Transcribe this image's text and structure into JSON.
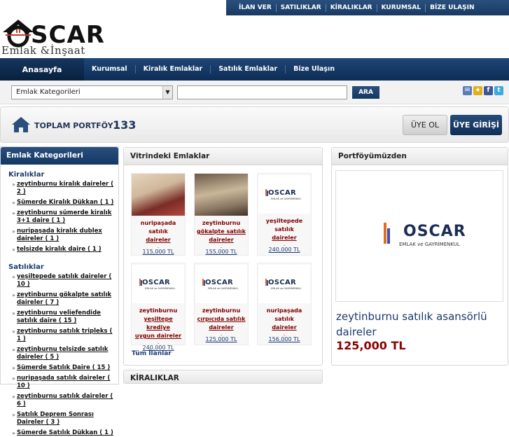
{
  "toplinks": [
    "İLAN VER",
    "SATILIKLAR",
    "KİRALIKLAR",
    "KURUMSAL",
    "BİZE ULAŞIN"
  ],
  "logo": {
    "word": "SCAR",
    "sub": "Emlak &İnşaat"
  },
  "nav": {
    "home": "Anasayfa",
    "items": [
      "Kurumsal",
      "Kiralık Emlaklar",
      "Satılık Emlaklar",
      "Bize Ulaşın"
    ]
  },
  "search": {
    "select_value": "Emlak Kategorileri",
    "button": "ARA"
  },
  "portfolio": {
    "label": "TOPLAM PORTFÖY :",
    "count": "133",
    "register": "ÜYE OL",
    "login": "ÜYE GİRİŞİ"
  },
  "sidebar": {
    "title": "Emlak Kategorileri",
    "kiraliklar_title": "Kiralıklar",
    "kiraliklar": [
      "zeytinburnu kiralık daireler ( 2 )",
      "Sümerde Kiralık Dükkan ( 1 )",
      "zeytinburnu sümerde kiralık 3+1 daire ( 1 )",
      "nuripaşada kiralık dublex daireler ( 1 )",
      "telsizde kiralık daire ( 1 )"
    ],
    "satiliklar_title": "Satılıklar",
    "satiliklar": [
      "yeşiltepede satılık daireler ( 10 )",
      "zeytinburnu gökalpte satılık daireler ( 7 )",
      "zeytinburnu veliefendide satılık daire ( 15 )",
      "zeytinburnu satılık tripleks ( 1 )",
      "zeytinburnu telsizde satılık daireler ( 5 )",
      "Sümerde Satılık Daire ( 15 )",
      "nuripaşada satılık daireler ( 10 )",
      "zeytinburnu satılık daireler ( 6 )",
      "Satılık Deprem Sonrası Daireler ( 3 )",
      "Sümerde Satılık Dükkan ( 1 )"
    ]
  },
  "vitrin": {
    "title": "Vitrindeki Emlaklar",
    "cards": [
      {
        "line1": "nuripaşada satılık",
        "line2": "daireler",
        "line3": "",
        "price": "115,000 TL"
      },
      {
        "line1": "zeytinburnu",
        "line2": "gökalpte satılık",
        "line3": "daireler",
        "price": "155,000 TL"
      },
      {
        "line1": "yeşiltepede satılık",
        "line2": "daireler",
        "line3": "",
        "price": "240,000 TL"
      },
      {
        "line1": "zeytinburnu",
        "line2": "yeşiltepe krediye",
        "line3": "uygun daireler",
        "price": "240,000 TL"
      },
      {
        "line1": "zeytinburnu",
        "line2": "çırpıcıda satılık",
        "line3": "daireler",
        "price": "125,000 TL"
      },
      {
        "line1": "nuripaşada satılık",
        "line2": "daireler",
        "line3": "",
        "price": "156,000 TL"
      }
    ],
    "all_link": "Tüm İlanlar",
    "logo_word": "OSCAR",
    "logo_sub": "EMLAK ve GAYRİMENKUL"
  },
  "portfoy": {
    "title": "Portföyümüzden",
    "logo_word": "OSCAR",
    "logo_sub": "EMLAK ve GAYRİMENKUL",
    "listing_line1": "zeytinburnu satılık asansörlü",
    "listing_line2": "daireler",
    "price": "125,000 TL"
  },
  "kiraliklar_section": "KİRALIKLAR"
}
